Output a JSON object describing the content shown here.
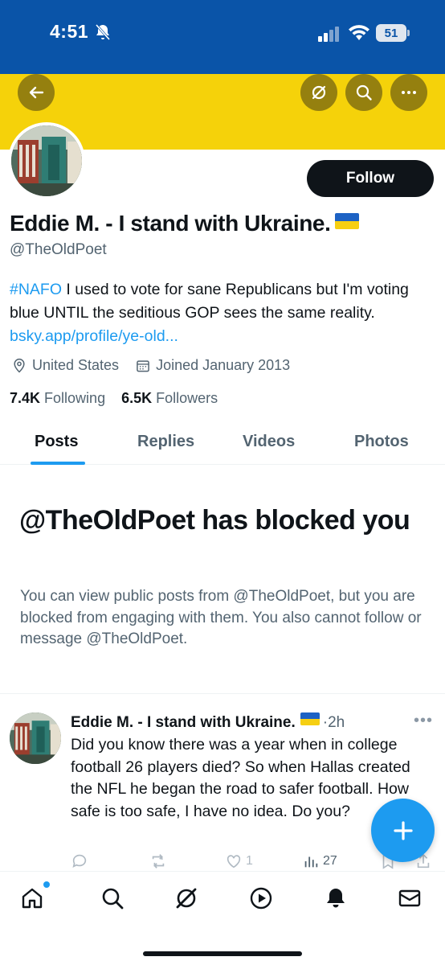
{
  "status_bar": {
    "time": "4:51",
    "battery": "51"
  },
  "profile": {
    "display_name": "Eddie M. - I stand with Ukraine.",
    "handle": "@TheOldPoet",
    "follow_label": "Follow",
    "bio_hashtag": "#NAFO",
    "bio_text": " I used to vote for sane Republicans but I'm voting blue UNTIL the seditious GOP sees the same reality. ",
    "bio_link": "bsky.app/profile/ye-old...",
    "location": "United States",
    "joined": "Joined January 2013",
    "following_count": "7.4K",
    "following_label": "Following",
    "followers_count": "6.5K",
    "followers_label": "Followers"
  },
  "tabs": [
    {
      "label": "Posts"
    },
    {
      "label": "Replies"
    },
    {
      "label": "Videos"
    },
    {
      "label": "Photos"
    }
  ],
  "blocked": {
    "title": "@TheOldPoet has blocked you",
    "text": "You can view public posts from @TheOldPoet, but you are blocked from engaging with them. You also cannot follow or message @TheOldPoet."
  },
  "post": {
    "author": "Eddie M. - I stand with Ukraine.",
    "time": "·2h",
    "text": "Did you know there was a year when in college football 26 players died? So when Hallas created the NFL he began the road to safer football. How safe is too safe, I have no idea. Do you?",
    "likes": "1",
    "views": "27"
  },
  "colors": {
    "banner_blue": "#0a54a8",
    "banner_yellow": "#f5d20a",
    "accent": "#1d9bf0"
  },
  "icons": [
    "back-arrow-icon",
    "grok-icon",
    "search-icon",
    "more-icon",
    "location-pin-icon",
    "calendar-icon",
    "reply-icon",
    "repost-icon",
    "like-icon",
    "views-icon",
    "bookmark-icon",
    "share-icon",
    "plus-icon",
    "home-icon",
    "notifications-icon",
    "messages-icon",
    "video-icon"
  ]
}
